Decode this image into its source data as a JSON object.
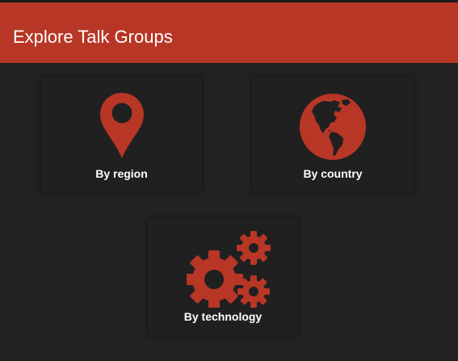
{
  "header": {
    "title": "Explore Talk Groups"
  },
  "cards": [
    {
      "label": "By region",
      "icon": "map-pin-icon"
    },
    {
      "label": "By country",
      "icon": "globe-icon"
    },
    {
      "label": "By technology",
      "icon": "gears-icon"
    }
  ],
  "colors": {
    "accent": "#b83626",
    "background": "#222222",
    "card": "#202020",
    "text": "#ffffff"
  }
}
